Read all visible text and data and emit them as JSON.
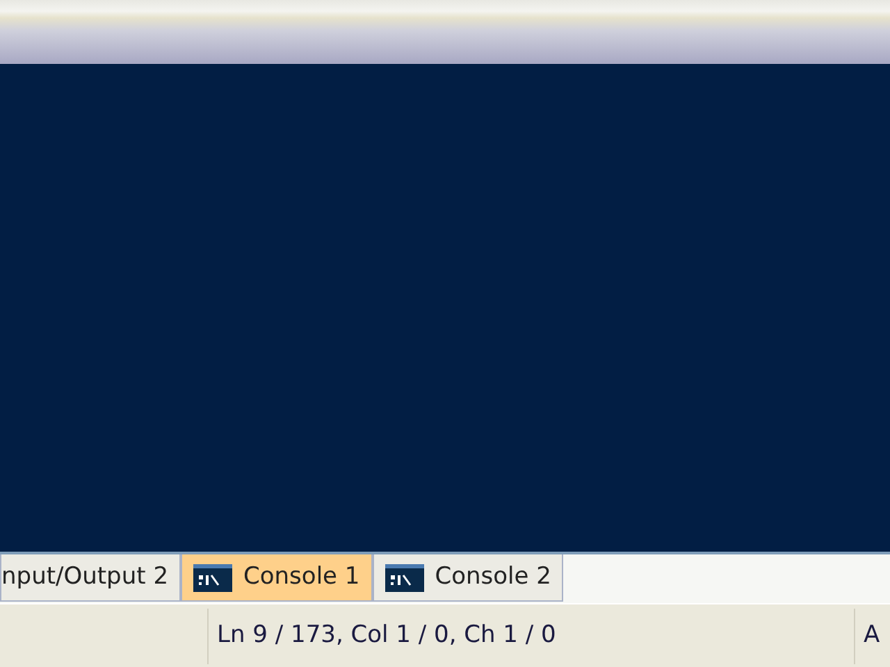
{
  "tabs": [
    {
      "label": "nput/Output 2",
      "kind": "plain",
      "selected": false
    },
    {
      "label": "Console 1",
      "kind": "console",
      "selected": true
    },
    {
      "label": "Console 2",
      "kind": "console",
      "selected": false
    }
  ],
  "status_bar": {
    "position": "Ln 9 / 173, Col 1 / 0, Ch 1 / 0",
    "section_3": "A"
  }
}
